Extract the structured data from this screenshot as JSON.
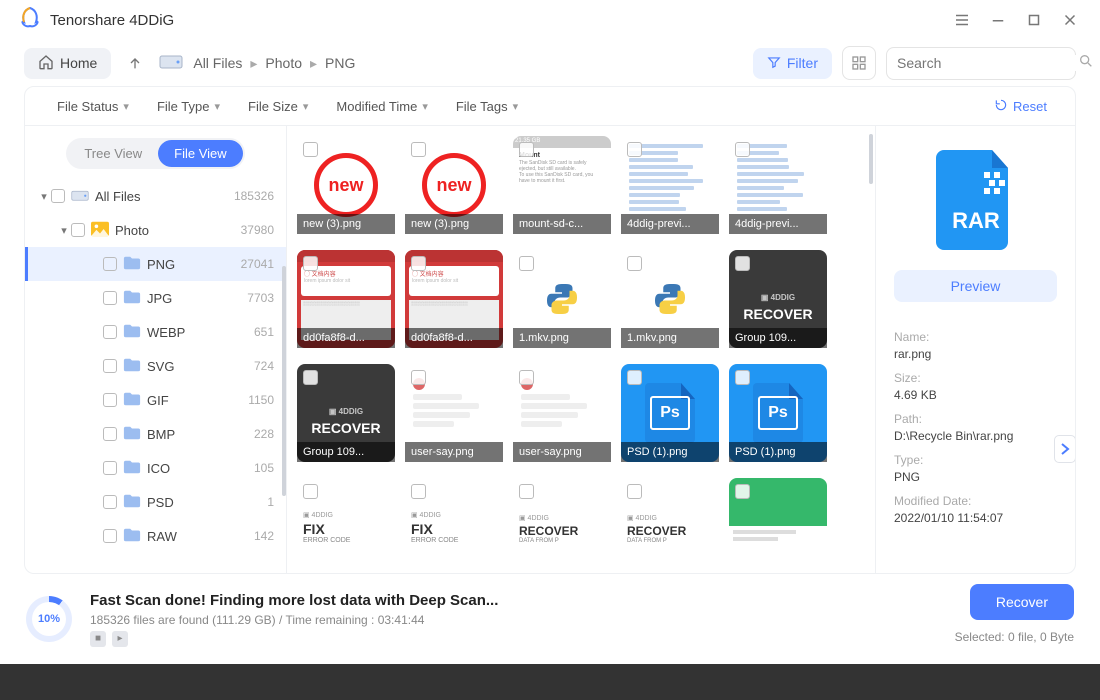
{
  "app": {
    "title": "Tenorshare 4DDiG"
  },
  "toolbar": {
    "home": "Home",
    "breadcrumb": [
      "All Files",
      "Photo",
      "PNG"
    ],
    "filter": "Filter",
    "search_placeholder": "Search"
  },
  "filters": {
    "items": [
      "File Status",
      "File Type",
      "File Size",
      "Modified Time",
      "File Tags"
    ],
    "reset": "Reset"
  },
  "view_toggle": {
    "tree": "Tree View",
    "file": "File View"
  },
  "tree": {
    "root": {
      "label": "All Files",
      "count": "185326"
    },
    "photo": {
      "label": "Photo",
      "count": "37980"
    },
    "children": [
      {
        "label": "PNG",
        "count": "27041",
        "selected": true
      },
      {
        "label": "JPG",
        "count": "7703"
      },
      {
        "label": "WEBP",
        "count": "651"
      },
      {
        "label": "SVG",
        "count": "724"
      },
      {
        "label": "GIF",
        "count": "1150"
      },
      {
        "label": "BMP",
        "count": "228"
      },
      {
        "label": "ICO",
        "count": "105"
      },
      {
        "label": "PSD",
        "count": "1"
      },
      {
        "label": "RAW",
        "count": "142"
      }
    ]
  },
  "grid": {
    "row1": [
      {
        "name": "new (3).png",
        "kind": "new"
      },
      {
        "name": "new (3).png",
        "kind": "new"
      },
      {
        "name": "mount-sd-c...",
        "kind": "doc"
      },
      {
        "name": "4ddig-previ...",
        "kind": "list"
      },
      {
        "name": "4ddig-previ...",
        "kind": "list"
      }
    ],
    "row2": [
      {
        "name": "dd0fa8f8-d...",
        "kind": "red"
      },
      {
        "name": "dd0fa8f8-d...",
        "kind": "red"
      },
      {
        "name": "1.mkv.png",
        "kind": "py"
      },
      {
        "name": "1.mkv.png",
        "kind": "py"
      },
      {
        "name": "Group 109...",
        "kind": "recover"
      }
    ],
    "row3": [
      {
        "name": "Group 109...",
        "kind": "recover"
      },
      {
        "name": "user-say.png",
        "kind": "chat"
      },
      {
        "name": "user-say.png",
        "kind": "chat"
      },
      {
        "name": "PSD (1).png",
        "kind": "ps"
      },
      {
        "name": "PSD (1).png",
        "kind": "ps"
      }
    ],
    "row4": [
      {
        "kind": "fix"
      },
      {
        "kind": "fix"
      },
      {
        "kind": "recoverw"
      },
      {
        "kind": "recoverw"
      },
      {
        "kind": "green"
      }
    ],
    "strings": {
      "4ddig": "4DDIG",
      "recover": "RECOVER",
      "fix": "FIX",
      "error_code": "ERROR CODE",
      "data_from": "DATA FROM P",
      "new": "new",
      "ps": "Ps",
      "rar": "RAR"
    }
  },
  "preview": {
    "button": "Preview",
    "name_label": "Name:",
    "name": "rar.png",
    "size_label": "Size:",
    "size": "4.69 KB",
    "path_label": "Path:",
    "path": "D:\\Recycle Bin\\rar.png",
    "type_label": "Type:",
    "type": "PNG",
    "mod_label": "Modified Date:",
    "mod": "2022/01/10 11:54:07"
  },
  "footer": {
    "progress": "10%",
    "title": "Fast Scan done! Finding more lost data with Deep Scan...",
    "subtitle": "185326 files are found (111.29 GB)  /  Time remaining : 03:41:44",
    "recover": "Recover",
    "selected": "Selected: 0 file, 0 Byte"
  }
}
